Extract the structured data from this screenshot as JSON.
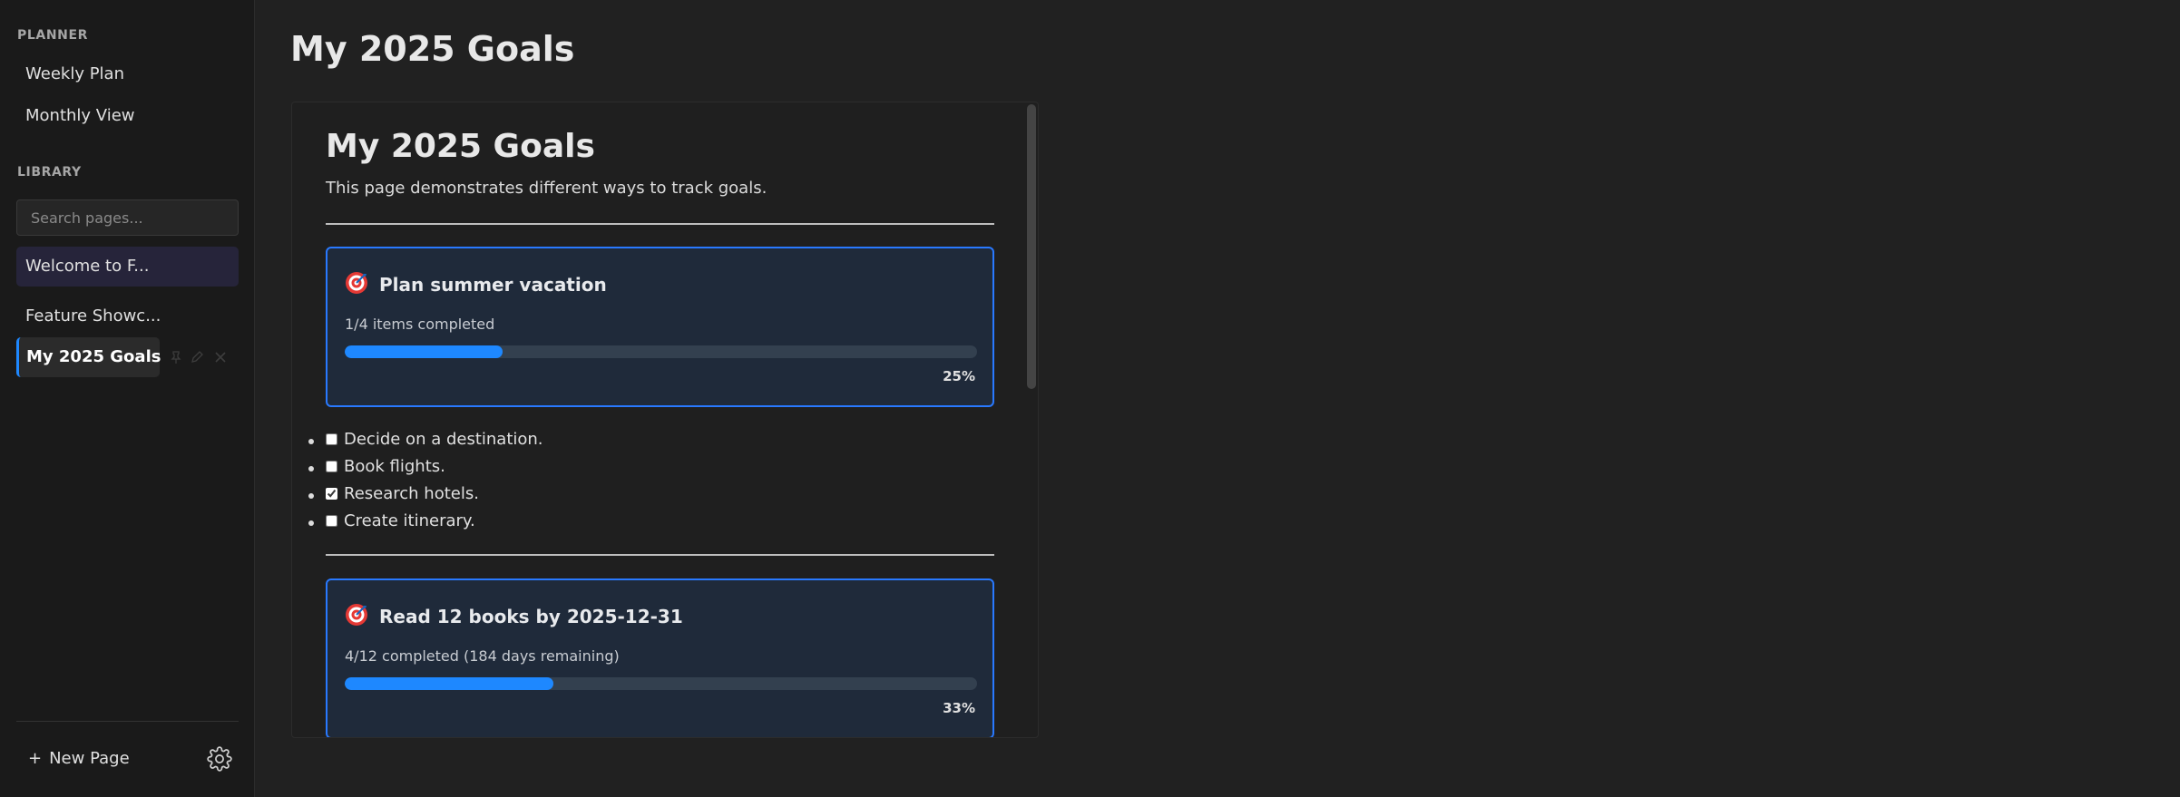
{
  "sidebar": {
    "planner_label": "PLANNER",
    "planner_items": [
      "Weekly Plan",
      "Monthly View"
    ],
    "library_label": "LIBRARY",
    "search_placeholder": "Search pages...",
    "pages": [
      "Welcome to F...",
      "Feature Showc...",
      "My 2025 Goals"
    ],
    "active_page": "My 2025 Goals",
    "new_page_label": "New Page",
    "new_page_icon": "plus-icon",
    "settings_icon": "gear-icon"
  },
  "main": {
    "title": "My 2025 Goals",
    "doc": {
      "heading": "My 2025 Goals",
      "intro": "This page demonstrates different ways to track goals.",
      "goals": [
        {
          "icon": "target-icon",
          "title": "Plan summer vacation",
          "status": "1/4 items completed",
          "percent_label": "25%",
          "progress": 0.25
        },
        {
          "icon": "target-icon",
          "title": "Read 12 books by 2025-12-31",
          "status": "4/12 completed (184 days remaining)",
          "percent_label": "33%",
          "progress": 0.33
        }
      ],
      "checklist": [
        {
          "label": "Decide on a destination.",
          "checked": false
        },
        {
          "label": "Book flights.",
          "checked": false
        },
        {
          "label": "Research hotels.",
          "checked": true
        },
        {
          "label": "Create itinerary.",
          "checked": false
        }
      ]
    }
  },
  "colors": {
    "accent": "#1e88ff",
    "card_border": "#2979ff",
    "card_bg": "#1f2a3a",
    "sidebar_bg": "#1a1a1a",
    "main_bg": "#212121"
  }
}
